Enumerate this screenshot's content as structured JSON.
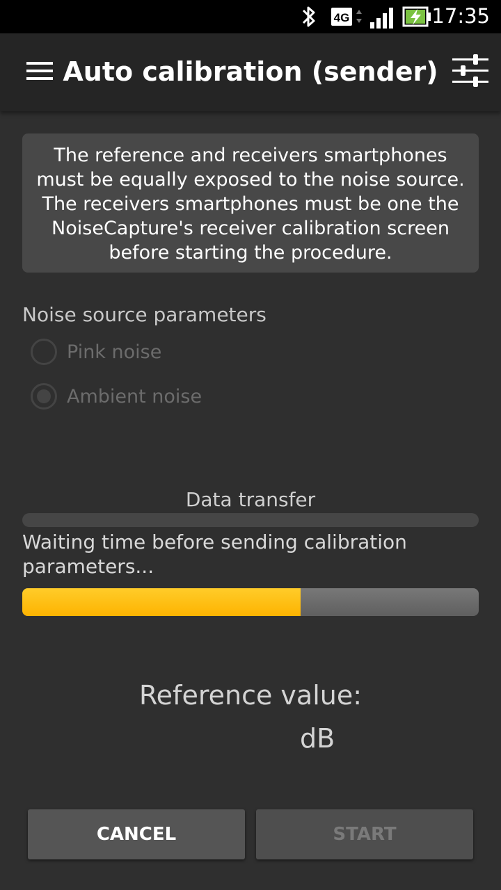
{
  "status_bar": {
    "network": "4G",
    "time": "17:35",
    "icons": [
      "bluetooth-icon",
      "network-4g-icon",
      "signal-icon",
      "battery-charging-icon"
    ]
  },
  "app_bar": {
    "title": "Auto calibration (sender)",
    "menu_icon": "hamburger-menu-icon",
    "settings_icon": "sliders-settings-icon"
  },
  "notice": {
    "lines": [
      "The reference and receivers smartphones",
      "must be equally exposed to the noise source.",
      "The receivers smartphones must be one the",
      "NoiseCapture's receiver calibration screen",
      "before starting the procedure."
    ]
  },
  "noise_source": {
    "title": "Noise source parameters",
    "options": [
      {
        "label": "Pink noise",
        "selected": false
      },
      {
        "label": "Ambient noise",
        "selected": true
      }
    ]
  },
  "data_transfer": {
    "label": "Data transfer",
    "progress": 0.0
  },
  "waiting": {
    "text": "Waiting time before sending calibration parameters...",
    "progress": 0.61
  },
  "reference": {
    "label": "Reference value:",
    "unit": "dB"
  },
  "buttons": {
    "cancel": "CANCEL",
    "start": "START"
  },
  "colors": {
    "accent": "#fdb300",
    "background": "#2f2f2f",
    "app_bar": "#252525",
    "notice_bg": "#484848"
  }
}
